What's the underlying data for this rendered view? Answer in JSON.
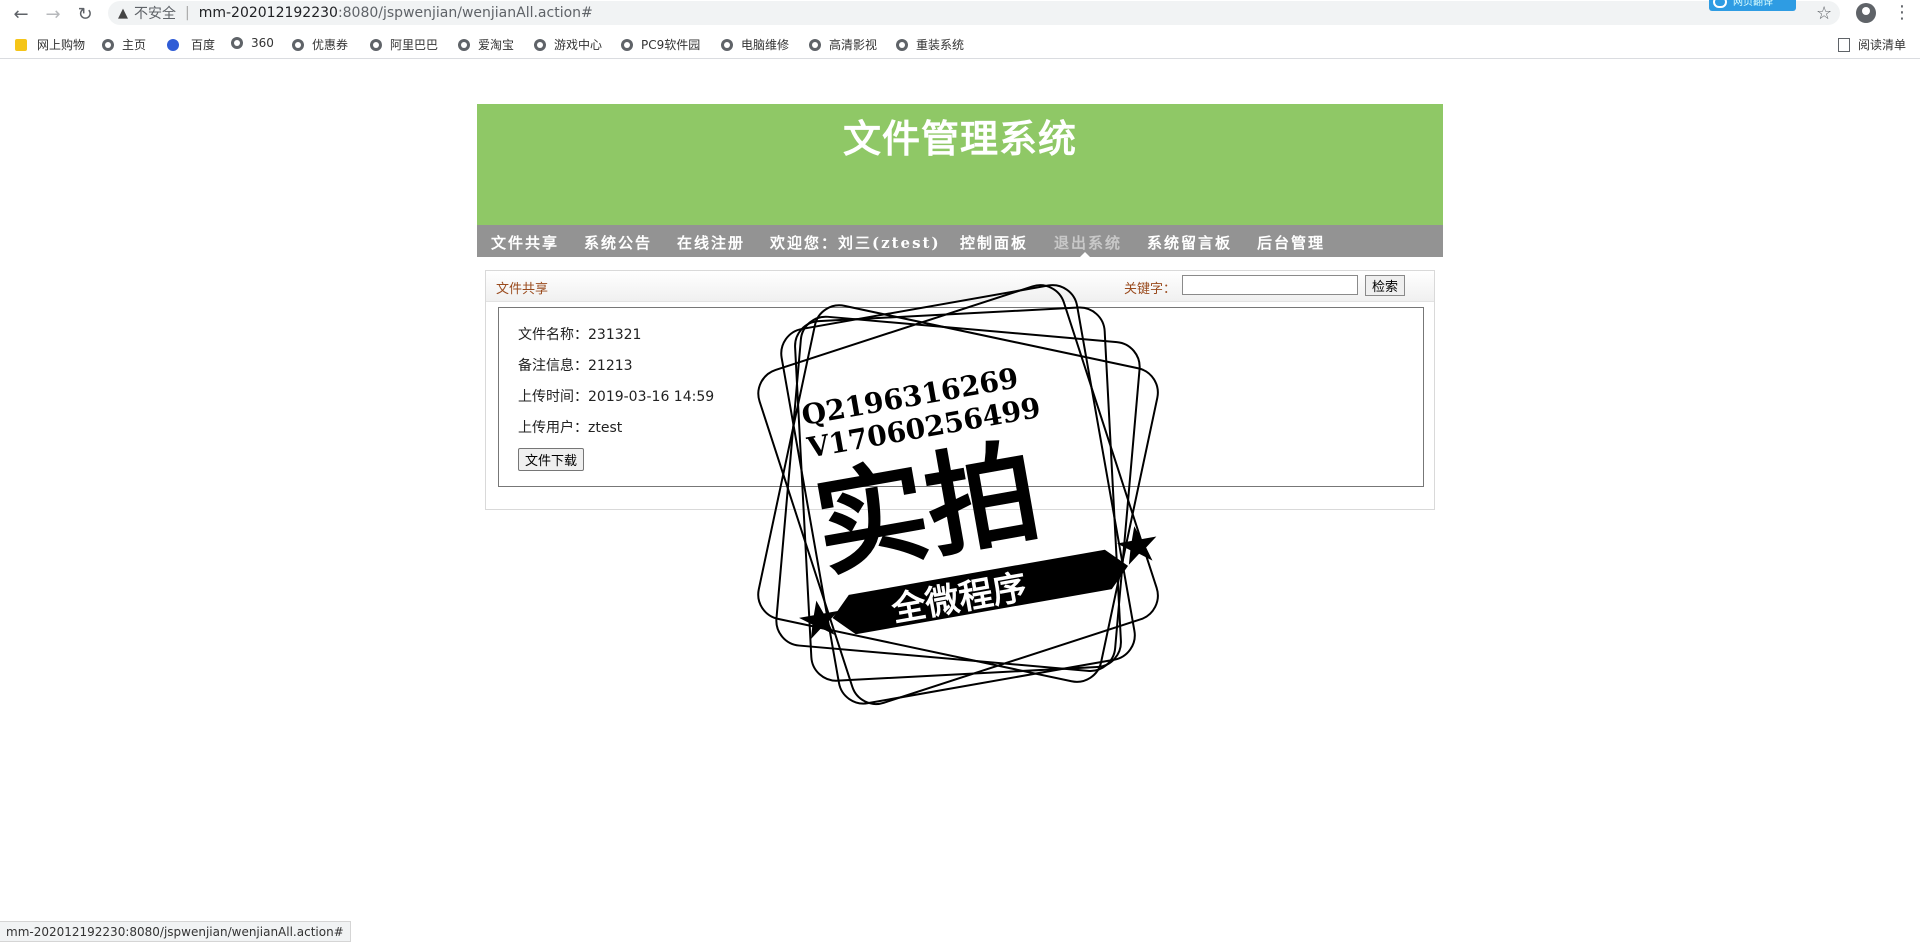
{
  "browser": {
    "insecure_label": "不安全",
    "url_host": "mm-202012192230",
    "url_rest": ":8080/jspwenjian/wenjianAll.action#",
    "ext_badge": "网页翻译",
    "reading_list": "阅读清单",
    "bookmarks": [
      "网上购物",
      "主页",
      "百度",
      "360",
      "优惠券",
      "阿里巴巴",
      "爱淘宝",
      "游戏中心",
      "PC9软件园",
      "电脑维修",
      "高清影视",
      "重装系统"
    ],
    "status_url": "mm-202012192230:8080/jspwenjian/wenjianAll.action#"
  },
  "site": {
    "title": "文件管理系统",
    "nav": [
      "文件共享",
      "系统公告",
      "在线注册",
      "欢迎您：刘三(ztest)",
      "控制面板",
      "退出系统",
      "系统留言板",
      "后台管理"
    ]
  },
  "panel": {
    "title": "文件共享",
    "keyword_label": "关键字：",
    "keyword_value": "",
    "search_label": "检索",
    "file": {
      "name": "文件名称：231321",
      "note": "备注信息：21213",
      "time": "上传时间：2019-03-16 14:59",
      "user": "上传用户：ztest",
      "download_label": "文件下载"
    }
  },
  "watermark": {
    "qq": "Q2196316269",
    "v": "V17060256499",
    "main": "实拍",
    "banner": "全微程序"
  }
}
